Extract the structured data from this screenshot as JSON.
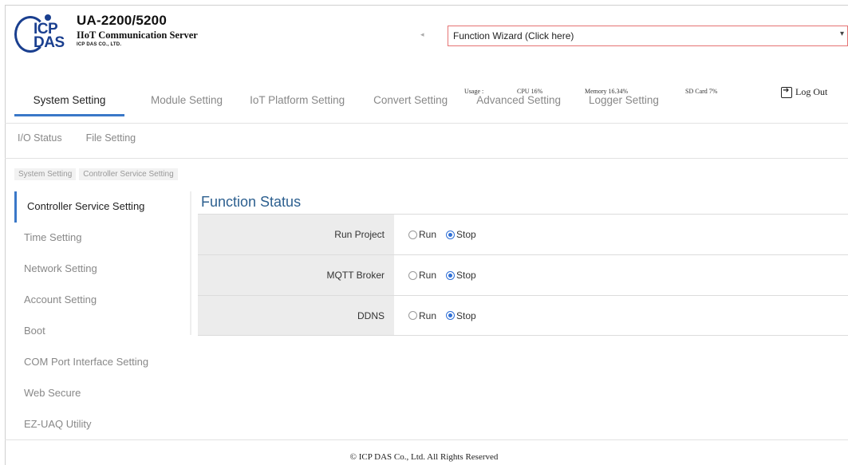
{
  "header": {
    "logo_top": "ICP",
    "logo_bottom": "DAS",
    "model": "UA-2200/5200",
    "subtitle": "IIoT Communication Server",
    "company": "ICP DAS CO., LTD.",
    "wizard_label": "Function Wizard  (Click here)",
    "usage": {
      "label": "Usage :",
      "cpu": "CPU  16%",
      "memory": "Memory  16.34%",
      "sd": "SD Card   7%"
    },
    "logout": "Log Out"
  },
  "menu": {
    "items": [
      {
        "label": "System Setting",
        "active": true
      },
      {
        "label": "Module Setting",
        "active": false
      },
      {
        "label": "IoT Platform Setting",
        "active": false
      },
      {
        "label": "Convert Setting",
        "active": false
      },
      {
        "label": "Advanced Setting",
        "active": false
      },
      {
        "label": "Logger Setting",
        "active": false
      }
    ],
    "sub": [
      "I/O Status",
      "File Setting"
    ]
  },
  "breadcrumb": [
    "System Setting",
    "Controller Service Setting"
  ],
  "sidenav": [
    "Controller Service Setting",
    "Time Setting",
    "Network Setting",
    "Account Setting",
    "Boot",
    "COM Port Interface Setting",
    "Web Secure",
    "EZ-UAQ Utility"
  ],
  "content": {
    "title": "Function Status",
    "rows": [
      {
        "label": "Run Project",
        "run": "Run",
        "stop": "Stop",
        "selected": "Stop"
      },
      {
        "label": "MQTT Broker",
        "run": "Run",
        "stop": "Stop",
        "selected": "Stop"
      },
      {
        "label": "DDNS",
        "run": "Run",
        "stop": "Stop",
        "selected": "Stop"
      }
    ]
  },
  "footer": "© ICP DAS Co., Ltd. All Rights Reserved",
  "colors": {
    "accent": "#3a78c8",
    "title": "#2c5f8f",
    "logo": "#1a3f8f"
  }
}
